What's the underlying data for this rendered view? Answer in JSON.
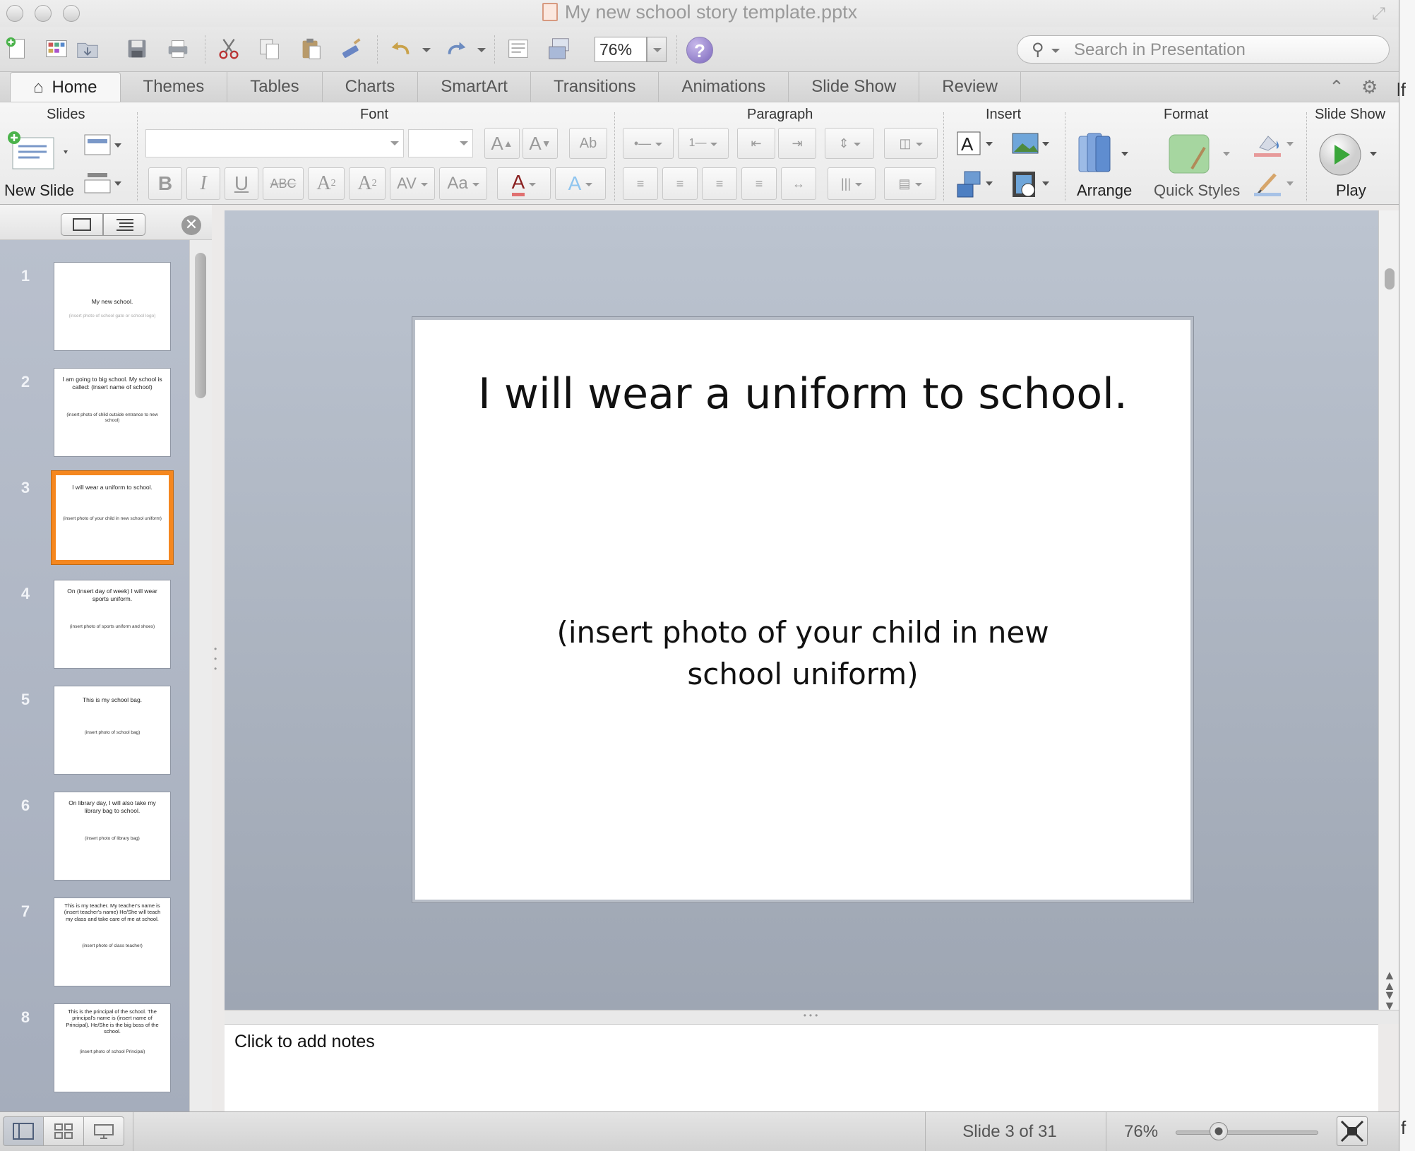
{
  "window": {
    "title": "My new school story template.pptx"
  },
  "toolbar": {
    "zoom_value": "76%",
    "search_placeholder": "Search in Presentation"
  },
  "tabs": [
    "Home",
    "Themes",
    "Tables",
    "Charts",
    "SmartArt",
    "Transitions",
    "Animations",
    "Slide Show",
    "Review"
  ],
  "active_tab": "Home",
  "ribbon": {
    "groups": {
      "slides": "Slides",
      "font": "Font",
      "paragraph": "Paragraph",
      "insert": "Insert",
      "format": "Format",
      "slideshow": "Slide Show"
    },
    "new_slide": "New Slide",
    "arrange": "Arrange",
    "quick_styles": "Quick Styles",
    "play": "Play"
  },
  "slides": [
    {
      "num": "1",
      "title": "My new school.",
      "body": "(insert photo of school gate or school logo)"
    },
    {
      "num": "2",
      "title": "I am going to big school. My school is called: (insert name of school)",
      "body": "(insert photo of child outside entrance to new school)"
    },
    {
      "num": "3",
      "title": "I will wear a uniform to school.",
      "body": "(insert photo of your child in new school uniform)"
    },
    {
      "num": "4",
      "title": "On (insert day of week) I will wear sports uniform.",
      "body": "(insert photo of sports uniform and shoes)"
    },
    {
      "num": "5",
      "title": "This is my school bag.",
      "body": "(insert photo of school bag)"
    },
    {
      "num": "6",
      "title": "On library day, I will also take my library bag to school.",
      "body": "(insert photo of library bag)"
    },
    {
      "num": "7",
      "title": "This is my teacher. My teacher's name is (insert teacher's name) He/She will teach my class and take care of me at school.",
      "body": "(insert photo of class teacher)"
    },
    {
      "num": "8",
      "title": "This is the principal of the school. The principal's name is (insert name of Principal). He/She is the big boss of the school.",
      "body": "(insert photo of school Principal)"
    }
  ],
  "current_slide": {
    "title": "I will wear a uniform to school.",
    "body": "(insert photo of your child in new school uniform)"
  },
  "notes": {
    "placeholder": "Click to add notes"
  },
  "status": {
    "slide_count": "Slide 3 of 31",
    "zoom": "76%",
    "zoom_level_pct": 30
  },
  "colors": {
    "selection": "#f5871f",
    "play_green": "#3aa63a"
  }
}
